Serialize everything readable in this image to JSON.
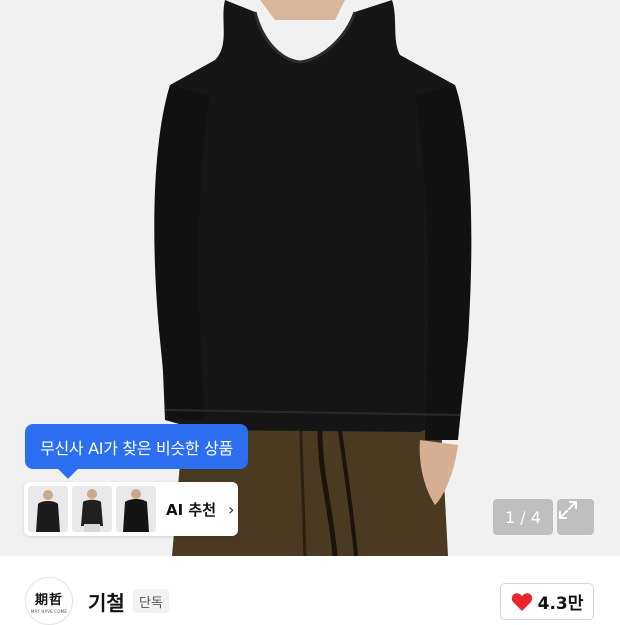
{
  "gallery": {
    "counter": "1 / 4",
    "ai_tooltip": "무신사 AI가 찾은 비슷한 상품",
    "ai_recommend_label": "AI 추천",
    "ai_recommend_chevron": "›",
    "thumbnails": [
      "thumbnail-1",
      "thumbnail-2",
      "thumbnail-3"
    ],
    "expand_icon": "expand-icon",
    "accent_color": "#2b6ff0"
  },
  "brand": {
    "logo_chars": "期哲",
    "logo_sub": "MAY HAVE COME",
    "name": "기철",
    "badge": "단독"
  },
  "like": {
    "icon": "heart-icon",
    "count": "4.3만",
    "color": "#e8262c"
  }
}
